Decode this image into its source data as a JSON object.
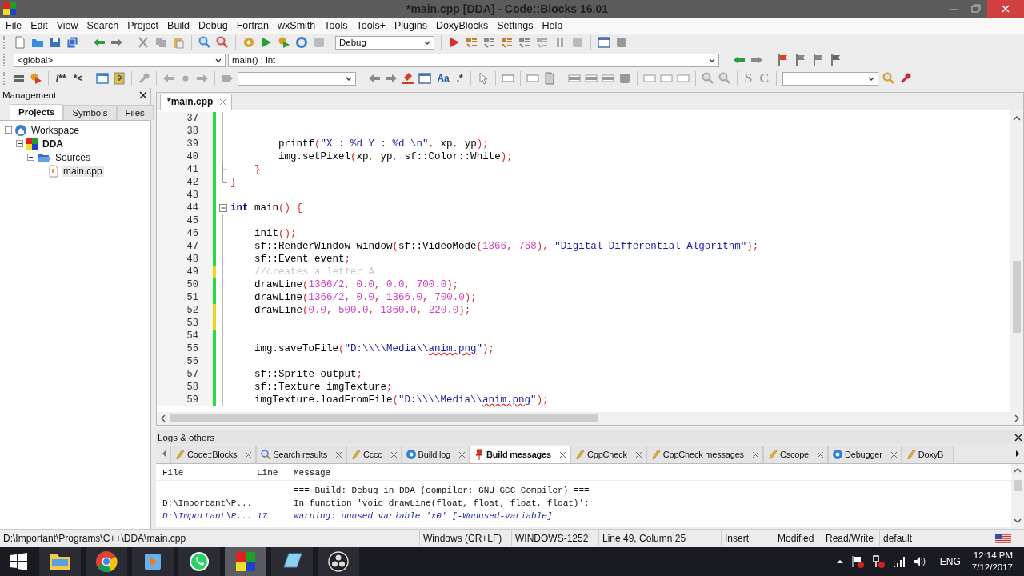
{
  "window": {
    "title": "*main.cpp [DDA] - Code::Blocks 16.01"
  },
  "menu": [
    "File",
    "Edit",
    "View",
    "Search",
    "Project",
    "Build",
    "Debug",
    "Fortran",
    "wxSmith",
    "Tools",
    "Tools+",
    "Plugins",
    "DoxyBlocks",
    "Settings",
    "Help"
  ],
  "toolbar": {
    "build_target": "Debug",
    "scope": "<global>",
    "function": "main() : int",
    "doc_buttons": [
      "/**",
      "*<"
    ],
    "match_case": "Aa",
    "regex": ".*",
    "style_buttons": [
      "S",
      "C"
    ]
  },
  "management": {
    "title": "Management",
    "tabs": [
      {
        "label": "Projects",
        "selected": true
      },
      {
        "label": "Symbols",
        "selected": false
      },
      {
        "label": "Files",
        "selected": false
      }
    ],
    "tree": [
      {
        "label": "Workspace",
        "kind": "workspace",
        "expanded": true,
        "selected": false,
        "children": [
          {
            "label": "DDA",
            "kind": "project",
            "expanded": true,
            "selected": false,
            "children": [
              {
                "label": "Sources",
                "kind": "folder",
                "expanded": true,
                "selected": false,
                "children": [
                  {
                    "label": "main.cpp",
                    "kind": "file",
                    "selected": true
                  }
                ]
              }
            ]
          }
        ]
      }
    ]
  },
  "editor": {
    "tabs": [
      {
        "label": "*main.cpp",
        "selected": true
      }
    ],
    "lines": [
      {
        "number": "37",
        "saved": true,
        "kind": "code"
      },
      {
        "number": "38",
        "saved": true,
        "kind": "code"
      },
      {
        "number": "39",
        "saved": true,
        "kind": "code",
        "segments": [
          {
            "kind": "plain",
            "text": "        printf"
          },
          {
            "kind": "op",
            "text": "("
          },
          {
            "kind": "string",
            "text": "\"X : %d Y : %d \\n\""
          },
          {
            "kind": "op",
            "text": ","
          },
          {
            "kind": "plain",
            "text": " xp"
          },
          {
            "kind": "op",
            "text": ","
          },
          {
            "kind": "plain",
            "text": " yp"
          },
          {
            "kind": "op",
            "text": ");"
          }
        ]
      },
      {
        "number": "40",
        "saved": true,
        "kind": "code",
        "segments": [
          {
            "kind": "plain",
            "text": "        img.setPixel"
          },
          {
            "kind": "op",
            "text": "("
          },
          {
            "kind": "plain",
            "text": "xp"
          },
          {
            "kind": "op",
            "text": ","
          },
          {
            "kind": "plain",
            "text": " yp"
          },
          {
            "kind": "op",
            "text": ","
          },
          {
            "kind": "plain",
            "text": " sf::Color::White"
          },
          {
            "kind": "op",
            "text": ");"
          }
        ]
      },
      {
        "number": "41",
        "saved": true,
        "kind": "branch",
        "segments": [
          {
            "kind": "op",
            "text": "    }"
          }
        ]
      },
      {
        "number": "42",
        "saved": true,
        "kind": "end",
        "segments": [
          {
            "kind": "op",
            "text": "}"
          }
        ]
      },
      {
        "number": "43",
        "saved": true,
        "kind": "gap"
      },
      {
        "number": "44",
        "saved": true,
        "kind": "fold",
        "segments": [
          {
            "kind": "keyword",
            "text": "int"
          },
          {
            "kind": "plain",
            "text": " main"
          },
          {
            "kind": "op",
            "text": "() {"
          }
        ]
      },
      {
        "number": "45",
        "saved": true,
        "kind": "code"
      },
      {
        "number": "46",
        "saved": true,
        "kind": "code",
        "segments": [
          {
            "kind": "plain",
            "text": "    init"
          },
          {
            "kind": "op",
            "text": "();"
          }
        ]
      },
      {
        "number": "47",
        "saved": true,
        "kind": "code",
        "segments": [
          {
            "kind": "plain",
            "text": "    sf::RenderWindow window"
          },
          {
            "kind": "op",
            "text": "("
          },
          {
            "kind": "plain",
            "text": "sf::VideoMode"
          },
          {
            "kind": "op",
            "text": "("
          },
          {
            "kind": "number",
            "text": "1366"
          },
          {
            "kind": "op",
            "text": ","
          },
          {
            "kind": "number",
            "text": " 768"
          },
          {
            "kind": "op",
            "text": "),"
          },
          {
            "kind": "string",
            "text": " \"Digital Differential Algorithm\""
          },
          {
            "kind": "op",
            "text": ");"
          }
        ]
      },
      {
        "number": "48",
        "saved": true,
        "kind": "code",
        "segments": [
          {
            "kind": "plain",
            "text": "    sf::Event event"
          },
          {
            "kind": "op",
            "text": ";"
          }
        ]
      },
      {
        "number": "49",
        "saved": false,
        "kind": "code",
        "segments": [
          {
            "kind": "comment",
            "text": "    //creates a letter A"
          }
        ]
      },
      {
        "number": "50",
        "saved": true,
        "kind": "code",
        "segments": [
          {
            "kind": "plain",
            "text": "    drawLine"
          },
          {
            "kind": "op",
            "text": "("
          },
          {
            "kind": "number",
            "text": "1366/2"
          },
          {
            "kind": "op",
            "text": ","
          },
          {
            "kind": "number",
            "text": " 0.0"
          },
          {
            "kind": "op",
            "text": ","
          },
          {
            "kind": "number",
            "text": " 0.0"
          },
          {
            "kind": "op",
            "text": ","
          },
          {
            "kind": "number",
            "text": " 700.0"
          },
          {
            "kind": "op",
            "text": ");"
          }
        ]
      },
      {
        "number": "51",
        "saved": true,
        "kind": "code",
        "segments": [
          {
            "kind": "plain",
            "text": "    drawLine"
          },
          {
            "kind": "op",
            "text": "("
          },
          {
            "kind": "number",
            "text": "1366/2"
          },
          {
            "kind": "op",
            "text": ","
          },
          {
            "kind": "number",
            "text": " 0.0"
          },
          {
            "kind": "op",
            "text": ","
          },
          {
            "kind": "number",
            "text": " 1366.0"
          },
          {
            "kind": "op",
            "text": ","
          },
          {
            "kind": "number",
            "text": " 700.0"
          },
          {
            "kind": "op",
            "text": ");"
          }
        ]
      },
      {
        "number": "52",
        "saved": false,
        "kind": "code",
        "segments": [
          {
            "kind": "plain",
            "text": "    drawLine"
          },
          {
            "kind": "op",
            "text": "("
          },
          {
            "kind": "number",
            "text": "0.0"
          },
          {
            "kind": "op",
            "text": ","
          },
          {
            "kind": "number",
            "text": " 500.0"
          },
          {
            "kind": "op",
            "text": ","
          },
          {
            "kind": "number",
            "text": " 1360.0"
          },
          {
            "kind": "op",
            "text": ","
          },
          {
            "kind": "number",
            "text": " 220.0"
          },
          {
            "kind": "op",
            "text": ");"
          }
        ]
      },
      {
        "number": "53",
        "saved": false,
        "kind": "code"
      },
      {
        "number": "54",
        "saved": true,
        "kind": "code"
      },
      {
        "number": "55",
        "saved": true,
        "kind": "code",
        "segments": [
          {
            "kind": "plain",
            "text": "    img.saveToFile"
          },
          {
            "kind": "op",
            "text": "("
          },
          {
            "kind": "string",
            "text": "\"D:\\\\\\\\Media\\\\"
          },
          {
            "kind": "misspelled",
            "text": "anim.png"
          },
          {
            "kind": "string",
            "text": "\""
          },
          {
            "kind": "op",
            "text": ");"
          }
        ]
      },
      {
        "number": "56",
        "saved": true,
        "kind": "code"
      },
      {
        "number": "57",
        "saved": true,
        "kind": "code",
        "segments": [
          {
            "kind": "plain",
            "text": "    sf::Sprite output"
          },
          {
            "kind": "op",
            "text": ";"
          }
        ]
      },
      {
        "number": "58",
        "saved": true,
        "kind": "code",
        "segments": [
          {
            "kind": "plain",
            "text": "    sf::Texture imgTexture"
          },
          {
            "kind": "op",
            "text": ";"
          }
        ]
      },
      {
        "number": "59",
        "saved": true,
        "kind": "code",
        "segments": [
          {
            "kind": "plain",
            "text": "    imgTexture.loadFromFile"
          },
          {
            "kind": "op",
            "text": "("
          },
          {
            "kind": "string",
            "text": "\"D:\\\\\\\\Media\\\\"
          },
          {
            "kind": "misspelled",
            "text": "anim.png"
          },
          {
            "kind": "string",
            "text": "\""
          },
          {
            "kind": "op",
            "text": ");"
          }
        ]
      }
    ]
  },
  "logs": {
    "title": "Logs & others",
    "tabs": [
      {
        "label": "Code::Blocks",
        "kind": "log",
        "selected": false
      },
      {
        "label": "Search results",
        "kind": "search",
        "selected": false
      },
      {
        "label": "Cccc",
        "kind": "log",
        "selected": false
      },
      {
        "label": "Build log",
        "kind": "gear",
        "selected": false
      },
      {
        "label": "Build messages",
        "kind": "pin",
        "selected": true
      },
      {
        "label": "CppCheck",
        "kind": "log",
        "selected": false
      },
      {
        "label": "CppCheck messages",
        "kind": "log",
        "selected": false
      },
      {
        "label": "Cscope",
        "kind": "log",
        "selected": false
      },
      {
        "label": "Debugger",
        "kind": "gear",
        "selected": false
      },
      {
        "label": "DoxyB",
        "kind": "log",
        "selected": false
      }
    ],
    "columns": [
      "File",
      "Line",
      "Message"
    ],
    "rows": [
      {
        "kind": "info",
        "message": "=== Build: Debug in DDA (compiler: GNU GCC Compiler) ==="
      },
      {
        "kind": "info",
        "file": "D:\\Important\\P...",
        "message": "In function 'void drawLine(float, float, float, float)':"
      },
      {
        "kind": "warning",
        "file": "D:\\Important\\P...",
        "line": "17",
        "message": "warning: unused variable 'x0' [-Wunused-variable]"
      }
    ]
  },
  "status_bar": [
    "D:\\Important\\Programs\\C++\\DDA\\main.cpp",
    "Windows (CR+LF)",
    "WINDOWS-1252",
    "Line 49, Column 25",
    "Insert",
    "Modified",
    "Read/Write",
    "default"
  ],
  "taskbar": {
    "apps": [
      {
        "kind": "explorer",
        "active": false
      },
      {
        "kind": "chrome",
        "active": false
      },
      {
        "kind": "media",
        "active": false
      },
      {
        "kind": "whatsapp",
        "active": false
      },
      {
        "kind": "codeblocks",
        "active": true
      },
      {
        "kind": "notes",
        "active": false
      },
      {
        "kind": "obs",
        "active": false
      }
    ],
    "language": "ENG",
    "time": "12:14 PM",
    "date": "7/12/2017"
  }
}
